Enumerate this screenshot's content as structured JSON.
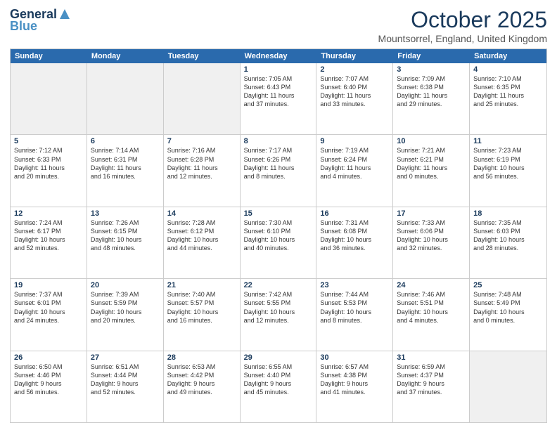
{
  "header": {
    "logo_line1": "General",
    "logo_line2": "Blue",
    "month": "October 2025",
    "location": "Mountsorrel, England, United Kingdom"
  },
  "days_of_week": [
    "Sunday",
    "Monday",
    "Tuesday",
    "Wednesday",
    "Thursday",
    "Friday",
    "Saturday"
  ],
  "weeks": [
    [
      {
        "day": "",
        "info": "",
        "shaded": true
      },
      {
        "day": "",
        "info": "",
        "shaded": true
      },
      {
        "day": "",
        "info": "",
        "shaded": true
      },
      {
        "day": "1",
        "info": "Sunrise: 7:05 AM\nSunset: 6:43 PM\nDaylight: 11 hours\nand 37 minutes."
      },
      {
        "day": "2",
        "info": "Sunrise: 7:07 AM\nSunset: 6:40 PM\nDaylight: 11 hours\nand 33 minutes."
      },
      {
        "day": "3",
        "info": "Sunrise: 7:09 AM\nSunset: 6:38 PM\nDaylight: 11 hours\nand 29 minutes."
      },
      {
        "day": "4",
        "info": "Sunrise: 7:10 AM\nSunset: 6:35 PM\nDaylight: 11 hours\nand 25 minutes."
      }
    ],
    [
      {
        "day": "5",
        "info": "Sunrise: 7:12 AM\nSunset: 6:33 PM\nDaylight: 11 hours\nand 20 minutes."
      },
      {
        "day": "6",
        "info": "Sunrise: 7:14 AM\nSunset: 6:31 PM\nDaylight: 11 hours\nand 16 minutes."
      },
      {
        "day": "7",
        "info": "Sunrise: 7:16 AM\nSunset: 6:28 PM\nDaylight: 11 hours\nand 12 minutes."
      },
      {
        "day": "8",
        "info": "Sunrise: 7:17 AM\nSunset: 6:26 PM\nDaylight: 11 hours\nand 8 minutes."
      },
      {
        "day": "9",
        "info": "Sunrise: 7:19 AM\nSunset: 6:24 PM\nDaylight: 11 hours\nand 4 minutes."
      },
      {
        "day": "10",
        "info": "Sunrise: 7:21 AM\nSunset: 6:21 PM\nDaylight: 11 hours\nand 0 minutes."
      },
      {
        "day": "11",
        "info": "Sunrise: 7:23 AM\nSunset: 6:19 PM\nDaylight: 10 hours\nand 56 minutes."
      }
    ],
    [
      {
        "day": "12",
        "info": "Sunrise: 7:24 AM\nSunset: 6:17 PM\nDaylight: 10 hours\nand 52 minutes."
      },
      {
        "day": "13",
        "info": "Sunrise: 7:26 AM\nSunset: 6:15 PM\nDaylight: 10 hours\nand 48 minutes."
      },
      {
        "day": "14",
        "info": "Sunrise: 7:28 AM\nSunset: 6:12 PM\nDaylight: 10 hours\nand 44 minutes."
      },
      {
        "day": "15",
        "info": "Sunrise: 7:30 AM\nSunset: 6:10 PM\nDaylight: 10 hours\nand 40 minutes."
      },
      {
        "day": "16",
        "info": "Sunrise: 7:31 AM\nSunset: 6:08 PM\nDaylight: 10 hours\nand 36 minutes."
      },
      {
        "day": "17",
        "info": "Sunrise: 7:33 AM\nSunset: 6:06 PM\nDaylight: 10 hours\nand 32 minutes."
      },
      {
        "day": "18",
        "info": "Sunrise: 7:35 AM\nSunset: 6:03 PM\nDaylight: 10 hours\nand 28 minutes."
      }
    ],
    [
      {
        "day": "19",
        "info": "Sunrise: 7:37 AM\nSunset: 6:01 PM\nDaylight: 10 hours\nand 24 minutes."
      },
      {
        "day": "20",
        "info": "Sunrise: 7:39 AM\nSunset: 5:59 PM\nDaylight: 10 hours\nand 20 minutes."
      },
      {
        "day": "21",
        "info": "Sunrise: 7:40 AM\nSunset: 5:57 PM\nDaylight: 10 hours\nand 16 minutes."
      },
      {
        "day": "22",
        "info": "Sunrise: 7:42 AM\nSunset: 5:55 PM\nDaylight: 10 hours\nand 12 minutes."
      },
      {
        "day": "23",
        "info": "Sunrise: 7:44 AM\nSunset: 5:53 PM\nDaylight: 10 hours\nand 8 minutes."
      },
      {
        "day": "24",
        "info": "Sunrise: 7:46 AM\nSunset: 5:51 PM\nDaylight: 10 hours\nand 4 minutes."
      },
      {
        "day": "25",
        "info": "Sunrise: 7:48 AM\nSunset: 5:49 PM\nDaylight: 10 hours\nand 0 minutes."
      }
    ],
    [
      {
        "day": "26",
        "info": "Sunrise: 6:50 AM\nSunset: 4:46 PM\nDaylight: 9 hours\nand 56 minutes."
      },
      {
        "day": "27",
        "info": "Sunrise: 6:51 AM\nSunset: 4:44 PM\nDaylight: 9 hours\nand 52 minutes."
      },
      {
        "day": "28",
        "info": "Sunrise: 6:53 AM\nSunset: 4:42 PM\nDaylight: 9 hours\nand 49 minutes."
      },
      {
        "day": "29",
        "info": "Sunrise: 6:55 AM\nSunset: 4:40 PM\nDaylight: 9 hours\nand 45 minutes."
      },
      {
        "day": "30",
        "info": "Sunrise: 6:57 AM\nSunset: 4:38 PM\nDaylight: 9 hours\nand 41 minutes."
      },
      {
        "day": "31",
        "info": "Sunrise: 6:59 AM\nSunset: 4:37 PM\nDaylight: 9 hours\nand 37 minutes."
      },
      {
        "day": "",
        "info": "",
        "shaded": true
      }
    ]
  ]
}
